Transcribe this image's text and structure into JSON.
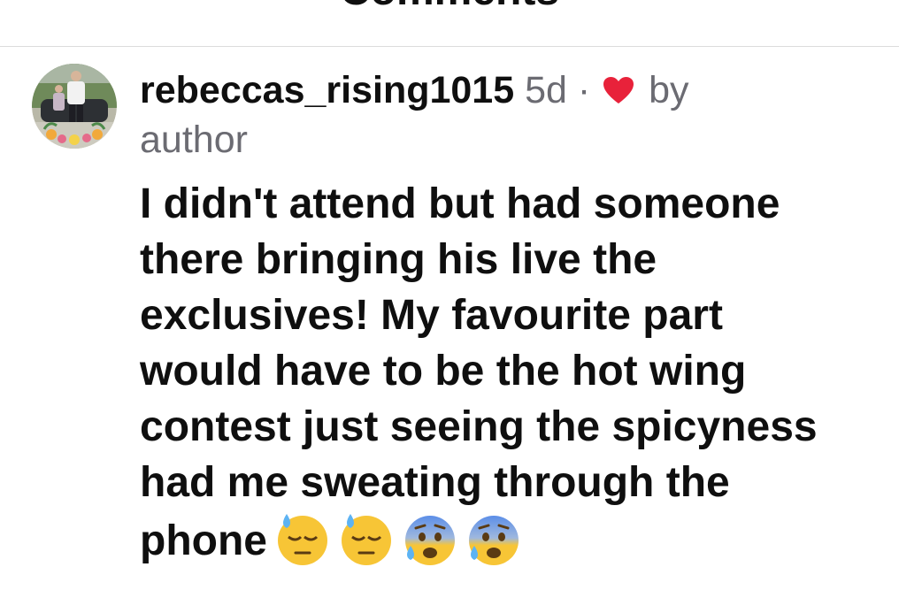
{
  "header": {
    "title": "Comments"
  },
  "comment": {
    "username": "rebeccas_rising1015",
    "timestamp": "5d",
    "separator": "·",
    "liked_by": "by",
    "liked_by_who": "author",
    "heart_color": "#e8223a",
    "text_lines": [
      "I didn't attend but had someone",
      "there bringing his live the",
      "exclusives! My favourite part",
      "would have to be the hot wing",
      "contest just seeing the spicyness",
      "had me sweating through the",
      "phone"
    ],
    "emojis": [
      "downcast-face-with-sweat",
      "downcast-face-with-sweat",
      "anxious-face-with-sweat",
      "anxious-face-with-sweat"
    ]
  }
}
